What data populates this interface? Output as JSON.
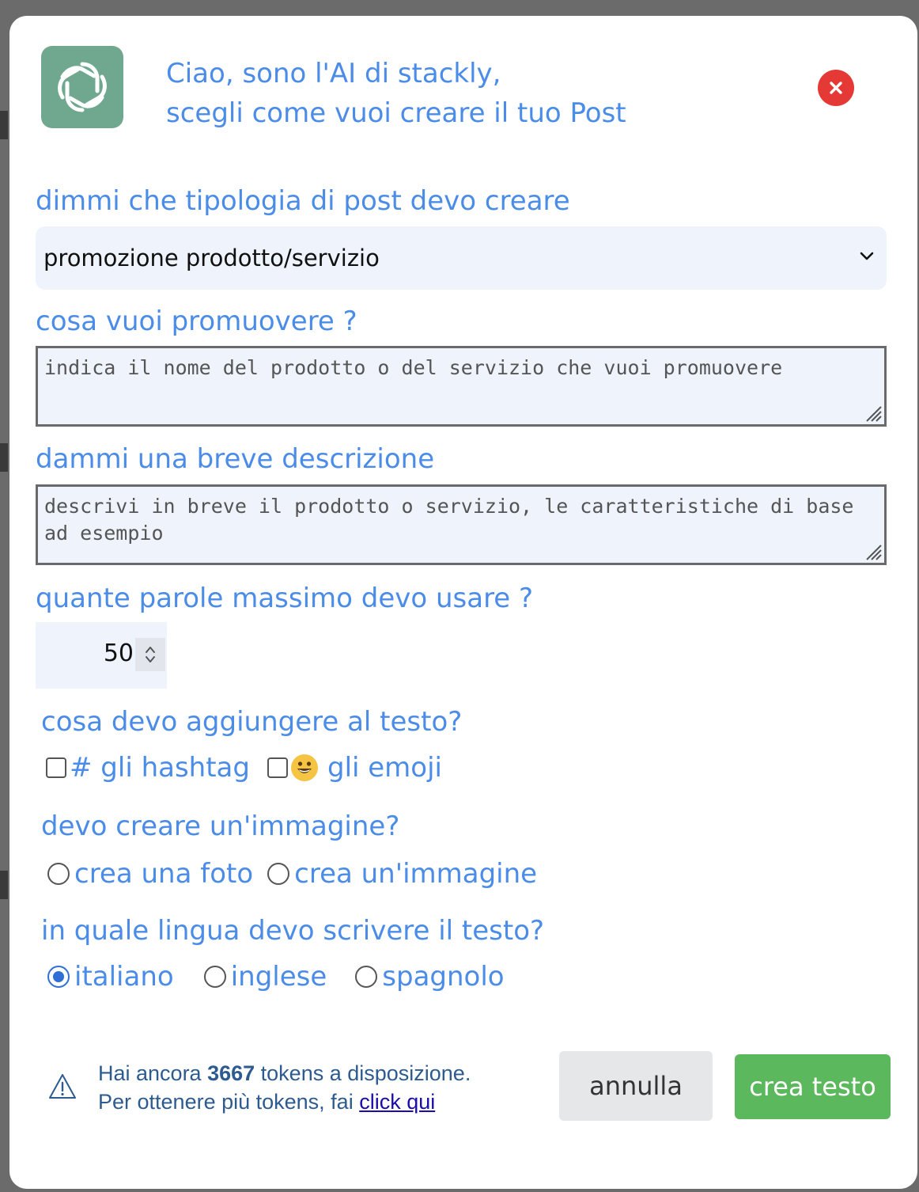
{
  "header": {
    "line1": "Ciao, sono l'AI di stackly,",
    "line2": "scegli come vuoi creare il tuo Post",
    "logo_icon": "openai-logo-icon",
    "close_icon": "close-icon"
  },
  "post_type": {
    "label": "dimmi che tipologia di post devo creare",
    "selected": "promozione prodotto/servizio"
  },
  "promote": {
    "label": "cosa vuoi promuovere ?",
    "placeholder": "indica il nome del prodotto o del servizio che vuoi promuovere"
  },
  "description": {
    "label": "dammi una breve descrizione",
    "placeholder": "descrivi in breve il prodotto o servizio, le caratteristiche di base ad esempio"
  },
  "words": {
    "label": "quante parole massimo devo usare ?",
    "value": "50"
  },
  "add": {
    "label": "cosa devo aggiungere al testo?",
    "hashtag_label": "# gli hashtag",
    "emoji_label": "gli emoji"
  },
  "image": {
    "label": "devo creare un'immagine?",
    "photo_label": "crea una foto",
    "image_label": "crea un'immagine"
  },
  "language": {
    "label": "in quale lingua devo scrivere il testo?",
    "options": [
      "italiano",
      "inglese",
      "spagnolo"
    ],
    "selected": "italiano"
  },
  "footer": {
    "tokens_prefix": "Hai ancora ",
    "tokens_count": "3667",
    "tokens_suffix": " tokens a disposizione.",
    "more_prefix": "Per ottenere più tokens, fai ",
    "more_link": "click qui",
    "cancel_label": "annulla",
    "create_label": "crea testo"
  },
  "colors": {
    "accent_blue": "#4a8ce8",
    "close_red": "#e53935",
    "create_green": "#5cb85c",
    "logo_green": "#6fa88f"
  }
}
